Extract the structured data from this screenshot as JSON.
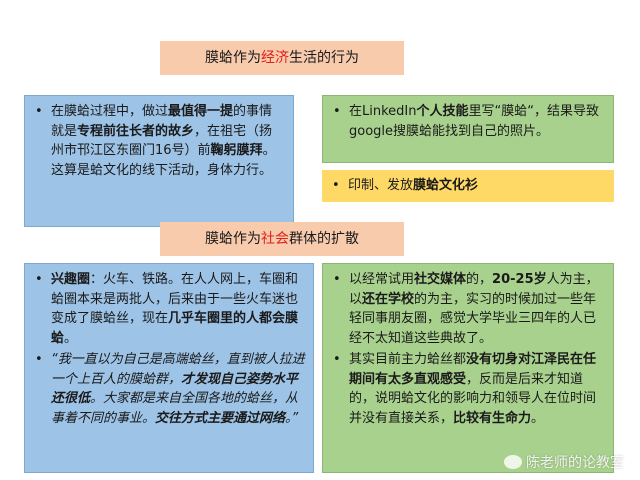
{
  "heading1": {
    "pre": "膜蛤作为",
    "hl": "经济",
    "post": "生活的行为"
  },
  "heading2": {
    "pre": "膜蛤作为",
    "hl": "社会",
    "post": "群体的扩散"
  },
  "box1": {
    "p1": "在膜蛤过程中，做过",
    "b1": "最值得一提",
    "p2": "的事情就是",
    "b2": "专程前往长者的故乡",
    "p3": "，在祖宅（扬州市邗江区东圈门16号）前",
    "b3": "鞠躬膜拜",
    "p4": "。这算是蛤文化的线下活动，身体力行。"
  },
  "box2": {
    "p1": "在LinkedIn",
    "b1": "个人技能",
    "p2": "里写“膜蛤“，结果导致google搜膜蛤能找到自己的照片。"
  },
  "box3": {
    "p1": "印制、发放",
    "b1": "膜蛤文化衫"
  },
  "box4": {
    "bullet1": {
      "b1": "兴趣圈",
      "p1": "：火车、铁路。在人人网上，车圈和蛤圈本来是两批人，后来由于一些火车迷也变成了膜蛤丝，现在",
      "b2": "几乎车圈里的人都会膜蛤",
      "p2": "。"
    },
    "bullet2": {
      "i1": "“我一直以为自己是高端蛤丝，直到被人拉进一个上百人的膜蛤群，",
      "bi1": "才发现自己姿势水平还很低",
      "i2": "。大家都是来自全国各地的蛤丝，从事着不同的事业。",
      "bi2": "交往方式主要通过网络",
      "i3": "。”"
    }
  },
  "box5": {
    "bullet1": {
      "p1": "以经常试用",
      "b1": "社交媒体",
      "p2": "的，",
      "b2": "20-25岁",
      "p3": "人为主，以",
      "b3": "还在学校",
      "p4": "的为主，实习的时候加过一些年轻同事朋友圈，感觉大学毕业三四年的人已经不太知道这些典故了。"
    },
    "bullet2": {
      "p1": "其实目前主力蛤丝都",
      "b1": "没有切身对江泽民在任期间有太多直观感受",
      "p2": "，反而是后来才知道的，说明蛤文化的影响力和领导人在位时间并没有直接关系，",
      "b2": "比较有生命力",
      "p3": "。"
    }
  },
  "watermark": {
    "text": "陈老师的论教室"
  }
}
